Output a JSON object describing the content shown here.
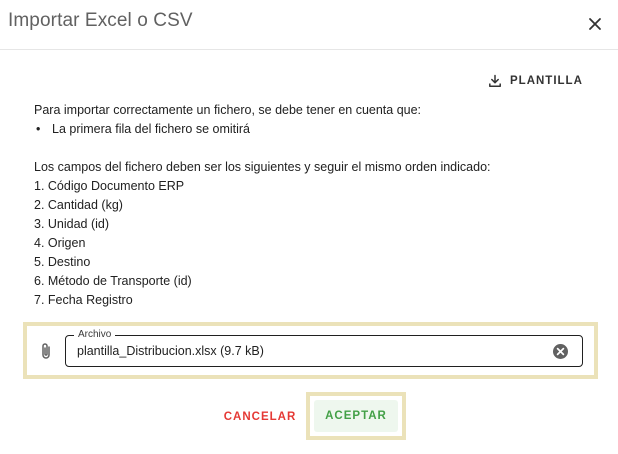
{
  "dialog": {
    "title": "Importar Excel o CSV",
    "close_icon": "close-icon"
  },
  "template_button": {
    "label": "PLANTILLA",
    "icon": "download-icon"
  },
  "instructions": {
    "intro": "Para importar correctamente un fichero, se debe tener en cuenta que:",
    "bullets": [
      "La primera fila del fichero se omitirá"
    ],
    "fields_intro": "Los campos del fichero deben ser los siguientes y seguir el mismo orden indicado:",
    "fields": [
      "1. Código Documento ERP",
      "2. Cantidad (kg)",
      "3. Unidad (id)",
      "4. Origen",
      "5. Destino",
      "6. Método de Transporte (id)",
      "7. Fecha Registro"
    ]
  },
  "file_input": {
    "label": "Archivo",
    "value": "plantilla_Distribucion.xlsx (9.7 kB)",
    "attach_icon": "paperclip-icon",
    "clear_icon": "clear-circle-icon"
  },
  "actions": {
    "cancel_label": "CANCELAR",
    "accept_label": "ACEPTAR"
  },
  "colors": {
    "cancel": "#e53935",
    "accept": "#43a047",
    "accept_background": "#eef7ee",
    "highlight_border": "#ebe2b9",
    "title": "#616161"
  }
}
